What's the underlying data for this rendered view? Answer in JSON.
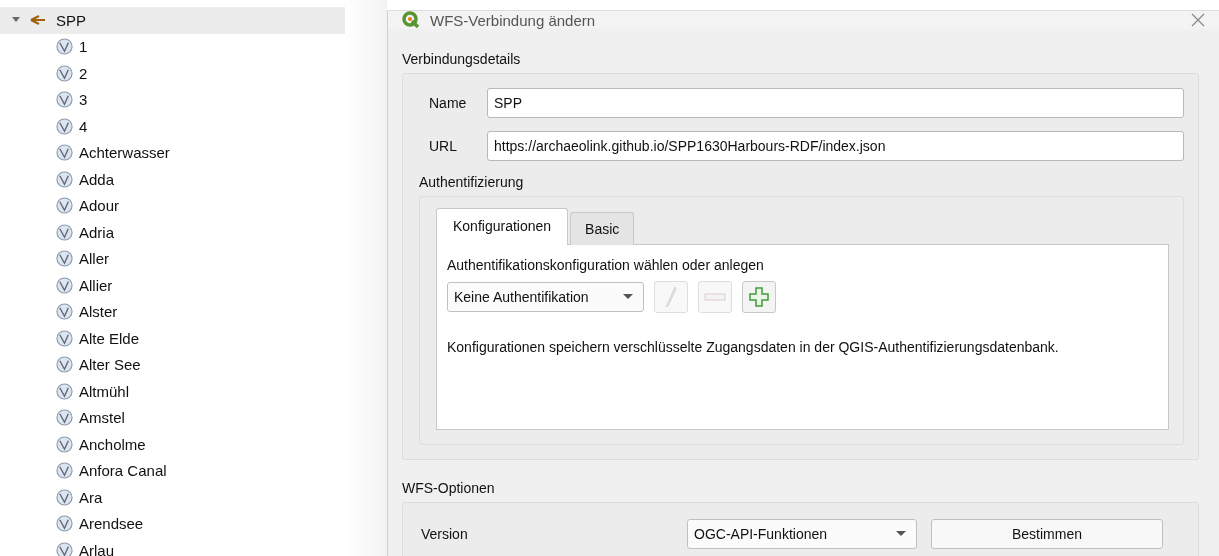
{
  "tree": {
    "label": "SPP",
    "expanded": true,
    "selected": true,
    "children": [
      {
        "label": "1",
        "selected": false
      },
      {
        "label": "2",
        "selected": false
      },
      {
        "label": "3",
        "selected": false
      },
      {
        "label": "4",
        "selected": false
      },
      {
        "label": "Achterwasser",
        "selected": false
      },
      {
        "label": "Adda",
        "selected": false
      },
      {
        "label": "Adour",
        "selected": false
      },
      {
        "label": "Adria",
        "selected": false
      },
      {
        "label": "Aller",
        "selected": false
      },
      {
        "label": "Allier",
        "selected": false
      },
      {
        "label": "Alster",
        "selected": false
      },
      {
        "label": "Alte Elde",
        "selected": false
      },
      {
        "label": "Alter See",
        "selected": false
      },
      {
        "label": "Altmühl",
        "selected": false
      },
      {
        "label": "Amstel",
        "selected": false
      },
      {
        "label": "Ancholme",
        "selected": false
      },
      {
        "label": "Anfora Canal",
        "selected": false
      },
      {
        "label": "Ara",
        "selected": false
      },
      {
        "label": "Arendsee",
        "selected": false
      },
      {
        "label": "Arlau",
        "selected": false
      }
    ]
  },
  "dialog": {
    "title": "WFS-Verbindung ändern",
    "connection": {
      "title": "Verbindungsdetails",
      "fields": [
        {
          "label": "Name",
          "value": "SPP"
        },
        {
          "label": "URL",
          "value": "https://archaeolink.github.io/SPP1630Harbours-RDF/index.json"
        }
      ]
    },
    "auth": {
      "title": "Authentifizierung",
      "tabs": [
        {
          "label": "Konfigurationen",
          "selected": true
        },
        {
          "label": "Basic",
          "selected": false
        }
      ],
      "prompt": "Authentifikationskonfiguration wählen oder anlegen",
      "config": "Keine Authentifikation",
      "buttons": [
        {
          "kind": "edit",
          "disabled": true
        },
        {
          "kind": "remove",
          "disabled": true
        },
        {
          "kind": "add",
          "disabled": false
        }
      ],
      "info": "Konfigurationen speichern verschlüsselte Zugangsdaten in der QGIS-Authentifizierungsdatenbank."
    },
    "options": {
      "title": "WFS-Optionen",
      "version_label": "Version",
      "version": "OGC-API-Funktionen",
      "detect_button": "Bestimmen"
    }
  }
}
